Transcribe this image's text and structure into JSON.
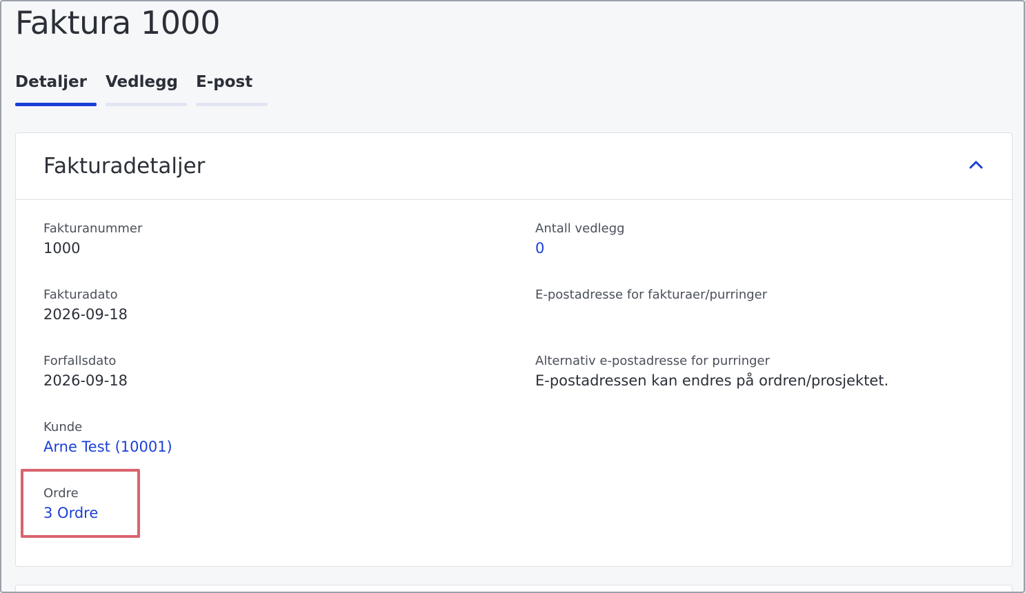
{
  "page": {
    "title": "Faktura 1000"
  },
  "tabs": [
    {
      "label": "Detaljer",
      "active": true
    },
    {
      "label": "Vedlegg",
      "active": false
    },
    {
      "label": "E-post",
      "active": false
    }
  ],
  "card": {
    "title": "Fakturadetaljer",
    "collapse_icon": "chevron-up-icon",
    "fields": {
      "invoice_number": {
        "label": "Fakturanummer",
        "value": "1000"
      },
      "invoice_date": {
        "label": "Fakturadato",
        "value": "2026-09-18"
      },
      "due_date": {
        "label": "Forfallsdato",
        "value": "2026-09-18"
      },
      "customer": {
        "label": "Kunde",
        "value": "Arne Test (10001)"
      },
      "order": {
        "label": "Ordre",
        "value": "3 Ordre"
      },
      "attachments": {
        "label": "Antall vedlegg",
        "value": "0"
      },
      "invoice_email": {
        "label": "E-postadresse for fakturaer/purringer",
        "value": ""
      },
      "alt_email": {
        "label": "Alternativ e-postadresse for purringer",
        "value": "E-postadressen kan endres på ordren/prosjektet."
      }
    }
  },
  "colors": {
    "accent": "#1a3fd6",
    "highlight": "#d9636e",
    "text": "#2b2f38"
  }
}
